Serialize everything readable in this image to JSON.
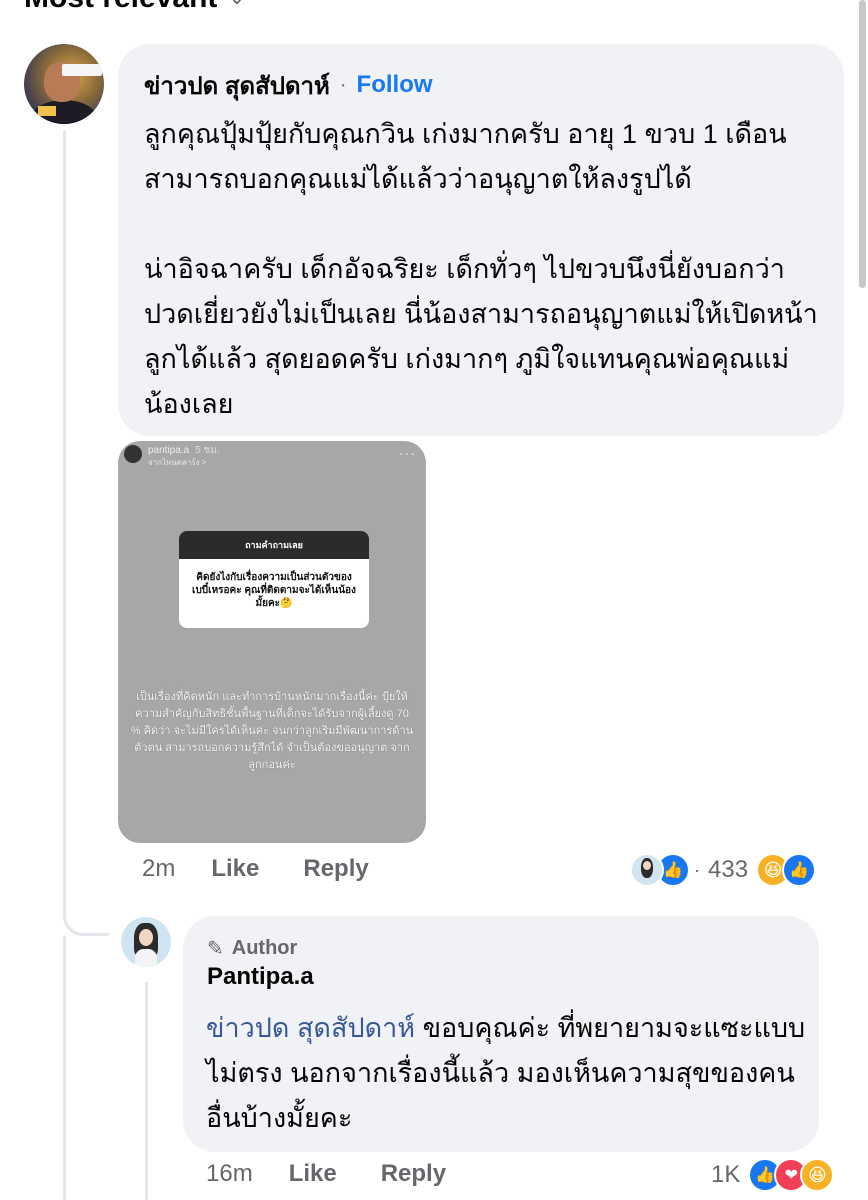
{
  "sort": {
    "label": "Most relevant"
  },
  "comment": {
    "author": "ข่าวปด สุดสัปดาห์",
    "separator": "·",
    "follow": "Follow",
    "paragraph1": "ลูกคุณปุ้มปุ้ยกับคุณกวิน เก่งมากครับ อายุ 1 ขวบ 1 เดือน สามารถบอกคุณแม่ได้แล้วว่าอนุญาตให้ลงรูปได้",
    "paragraph2": "น่าอิจฉาครับ เด็กอัจฉริยะ เด็กทั่วๆ ไปขวบนึงนี่ยังบอกว่าปวดเยี่ยวยังไม่เป็นเลย นี่น้องสามารถอนุญาตแม่ให้เปิดหน้าลูกได้แล้ว สุดยอดครับ เก่งมากๆ ภูมิใจแทนคุณพ่อคุณแม่น้องเลย",
    "time": "2m",
    "like": "Like",
    "reply": "Reply",
    "reaction_count": "433",
    "reaction_sep": "·",
    "story": {
      "username": "pantipa.a",
      "time": "5 ชม.",
      "subline": "จากไหนตลาร์ง >",
      "more": "···",
      "question_header": "ถามคำถามเลย",
      "question_text": "คิดยังไงกับเรื่องความเป็นส่วนตัวของเบบี๋เหรอคะ คุณที่ติดตามจะได้เห็นน้องมั้ยคะ🤔",
      "caption": "เป็นเรื่องที่คิดหนัก และทำการบ้านหนักมากเรื่องนี้ค่ะ ปุ้ยให้ความสำคัญกับสิทธิชั้นพื้นฐานที่เด็กจะได้รับจากผู้เลี้ยงดู 70 % คิดว่า จะไม่มีใครได้เห็นค่ะ จนกว่าลูกเริ่มมีพัฒนาการด้านตัวตน สามารถบอกความรู้สึกได้ จำเป็นต้องขออนุญาต จากลูกก่อนค่ะ"
    }
  },
  "reply_comment": {
    "badge": "Author",
    "author": "Pantipa.a",
    "mention": "ข่าวปด สุดสัปดาห์",
    "text": " ขอบคุณค่ะ ที่พยายามจะแซะแบบไม่ตรง นอกจากเรื่องนี้แล้ว มองเห็นความสุขของคนอื่นบ้างมั้ยคะ",
    "time": "16m",
    "like": "Like",
    "reply": "Reply",
    "reaction_count": "1K"
  },
  "icons": {
    "chevron": "chevron-down-icon",
    "pen": "pen-icon",
    "like": "like-icon",
    "love": "love-icon",
    "haha": "haha-icon"
  },
  "colors": {
    "link": "#1877f2",
    "mention": "#385898",
    "bubble": "#f0f2f5",
    "muted": "#65676b"
  }
}
